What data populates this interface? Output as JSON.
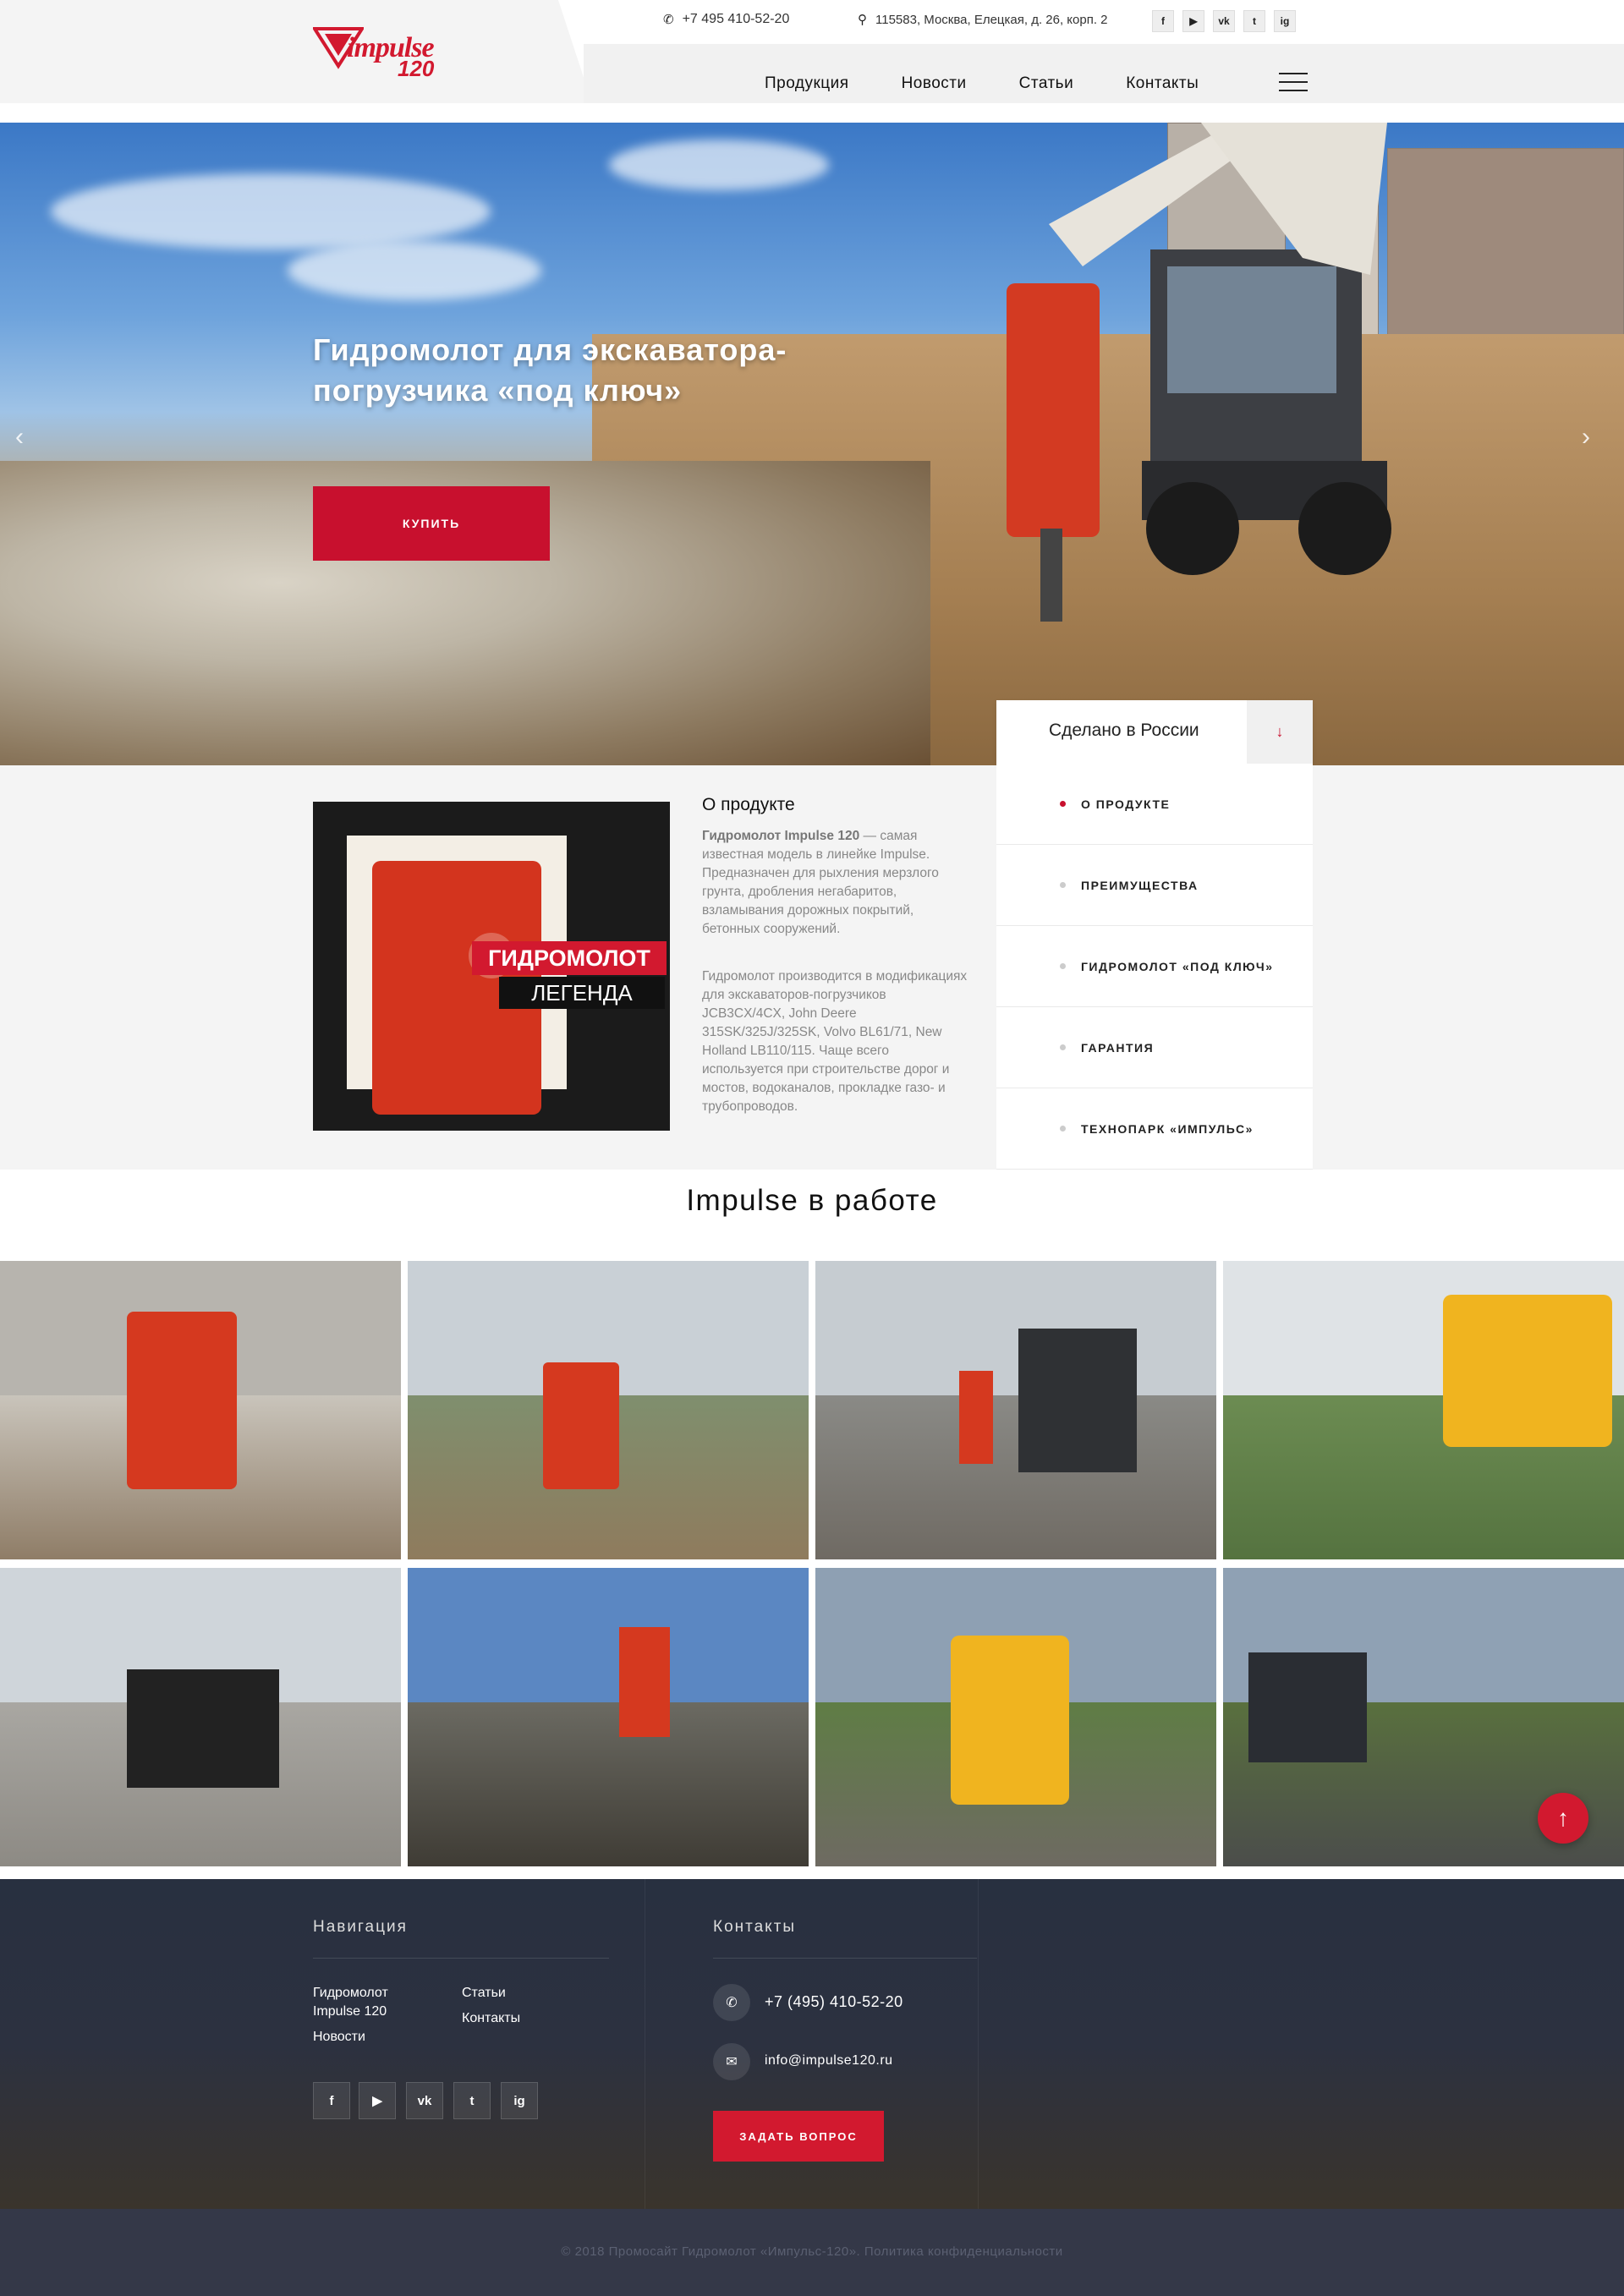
{
  "header": {
    "logo_word": "impulse",
    "logo_num": "120",
    "phone": "+7 495 410-52-20",
    "address": "115583, Москва, Елецкая, д. 26, корп. 2",
    "social": [
      "f",
      "▶",
      "vk",
      "t",
      "ig"
    ],
    "nav": [
      "Продукция",
      "Новости",
      "Статьи",
      "Контакты"
    ]
  },
  "hero": {
    "title": "Гидромолот для экскаватора-погрузчика «под ключ»",
    "buy_label": "КУПИТЬ"
  },
  "side_menu": {
    "heading": "Сделано в России",
    "items": [
      "О ПРОДУКТЕ",
      "ПРЕИМУЩЕСТВА",
      "ГИДРОМОЛОТ «ПОД КЛЮЧ»",
      "ГАРАНТИЯ",
      "ТЕХНОПАРК «ИМПУЛЬС»"
    ],
    "active_index": 0
  },
  "about": {
    "title": "О продукте",
    "p1_bold": "Гидромолот Impulse 120",
    "p1_rest": " — самая известная модель в линейке Impulse. Предназначен для рыхления мерзлого грунта, дробления негабаритов, взламывания дорожных покрытий, бетонных сооружений.",
    "p2": "Гидромолот производится в модификациях для экскаваторов-погрузчиков JCB3CX/4CX, John Deere 315SK/325J/325SK, Volvo BL61/71, New Holland LB110/115. Чаще всего используется при строительстве дорог и мостов, водоканалов, прокладке газо- и трубопроводов.",
    "video_line1": "ГИДРОМОЛОТ",
    "video_line2": "ЛЕГЕНДА"
  },
  "gallery": {
    "title": "Impulse в работе"
  },
  "footer": {
    "nav_title": "Навигация",
    "nav_col1": [
      "Гидромолот Impulse 120",
      "Новости"
    ],
    "nav_col2": [
      "Статьи",
      "Контакты"
    ],
    "contacts_title": "Контакты",
    "phone": "+7 (495) 410-52-20",
    "email": "info@impulse120.ru",
    "ask_label": "ЗАДАТЬ ВОПРОС",
    "social": [
      "f",
      "▶",
      "vk",
      "t",
      "ig"
    ],
    "copyright": "© 2018 Промосайт Гидромолот «Импульс-120». Политика конфиденциальности"
  },
  "colors": {
    "accent": "#c8102e",
    "footer_bg": "#2c3140",
    "bottom_bg": "#343848"
  }
}
